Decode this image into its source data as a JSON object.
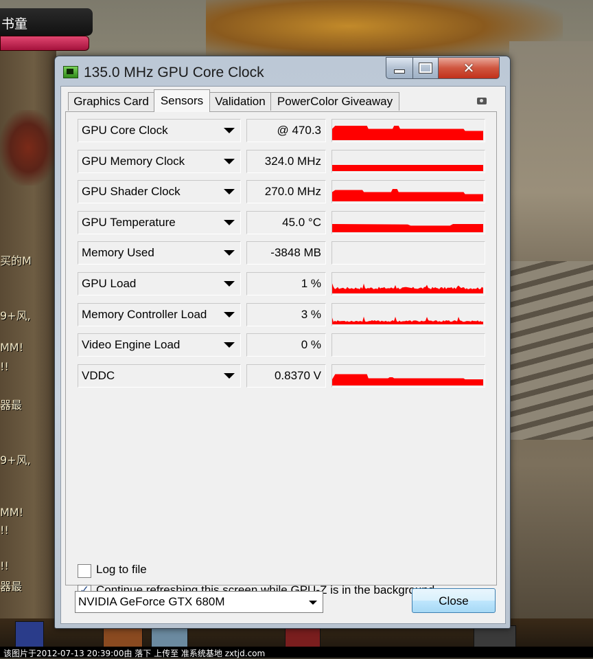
{
  "background": {
    "game_title": "书童",
    "chat_lines": [
      "买的M",
      "9+风,",
      "MM!",
      "!!",
      "器最",
      "9+风,",
      "MM!",
      "!!",
      "!!",
      "器最"
    ]
  },
  "window": {
    "title": "135.0 MHz GPU Core Clock",
    "controls": {
      "minimize": "minimize",
      "maximize": "maximize",
      "close": "close"
    }
  },
  "tabs": [
    {
      "label": "Graphics Card",
      "active": false
    },
    {
      "label": "Sensors",
      "active": true
    },
    {
      "label": "Validation",
      "active": false
    },
    {
      "label": "PowerColor Giveaway",
      "active": false
    }
  ],
  "sensors": [
    {
      "label": "GPU Core Clock",
      "value": "@ 470.3"
    },
    {
      "label": "GPU Memory Clock",
      "value": "324.0 MHz"
    },
    {
      "label": "GPU Shader Clock",
      "value": "270.0 MHz"
    },
    {
      "label": "GPU Temperature",
      "value": "45.0 °C"
    },
    {
      "label": "Memory Used",
      "value": "-3848 MB"
    },
    {
      "label": "GPU Load",
      "value": "1 %"
    },
    {
      "label": "Memory Controller Load",
      "value": "3 %"
    },
    {
      "label": "Video Engine Load",
      "value": "0 %"
    },
    {
      "label": "VDDC",
      "value": "0.8370 V"
    }
  ],
  "options": {
    "log_to_file": {
      "label": "Log to file",
      "checked": false
    },
    "continue_refresh": {
      "label": "Continue refreshing this screen while GPU-Z is in the background",
      "checked": true
    }
  },
  "gpu_select": {
    "value": "NVIDIA GeForce GTX 680M"
  },
  "buttons": {
    "close": "Close"
  },
  "caption": "该图片于2012-07-13 20:39:00由 落下 上传至 准系统基地 zxtjd.com",
  "colors": {
    "graph": "#ff0000",
    "accent": "#3c7fb1"
  }
}
